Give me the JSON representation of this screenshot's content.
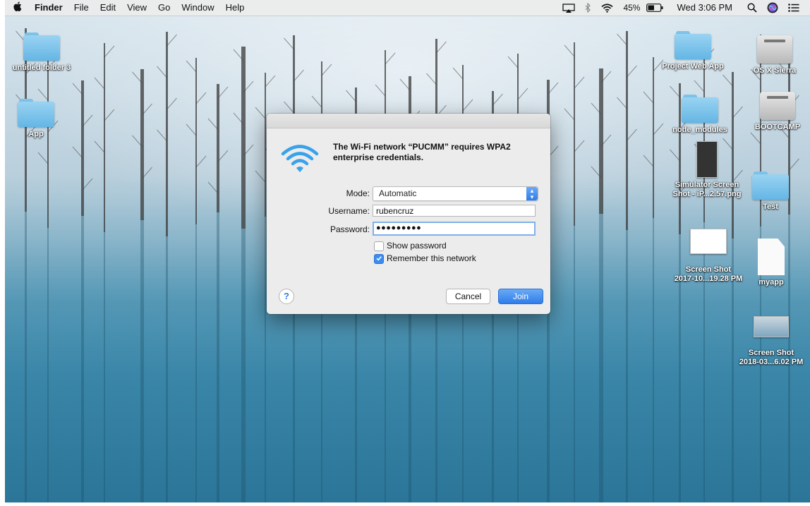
{
  "menubar": {
    "apple": "",
    "app": "Finder",
    "items": [
      "File",
      "Edit",
      "View",
      "Go",
      "Window",
      "Help"
    ],
    "battery": "45%",
    "clock": "Wed 3:06 PM"
  },
  "desktop": {
    "icons": [
      {
        "label": "untitled folder 3",
        "kind": "folder"
      },
      {
        "label": "App",
        "kind": "folder"
      },
      {
        "label": "Project Web App",
        "kind": "folder"
      },
      {
        "label": "OS X Sierra",
        "kind": "drive"
      },
      {
        "label": "node_modules",
        "kind": "folder"
      },
      {
        "label": "BOOTCAMP",
        "kind": "drive"
      },
      {
        "label": "Simulator Screen Shot - iP...2.57.png",
        "line1": "Simulator Screen",
        "line2": "Shot - iP...2.57.png",
        "kind": "image"
      },
      {
        "label": "Test",
        "kind": "folder"
      },
      {
        "label": "Screen Shot 2017-10...19.28 PM",
        "line1": "Screen Shot",
        "line2": "2017-10...19.28 PM",
        "kind": "image"
      },
      {
        "label": "myapp",
        "kind": "document"
      },
      {
        "label": "Screen Shot 2018-03...6.02 PM",
        "line1": "Screen Shot",
        "line2": "2018-03...6.02 PM",
        "kind": "image"
      }
    ]
  },
  "dialog": {
    "message": "The Wi-Fi network “PUCMM” requires WPA2 enterprise credentials.",
    "mode_label": "Mode:",
    "mode_value": "Automatic",
    "username_label": "Username:",
    "username_value": "rubencruz",
    "password_label": "Password:",
    "password_value": "●●●●●●●●●",
    "show_password_label": "Show password",
    "remember_label": "Remember this network",
    "cancel_label": "Cancel",
    "join_label": "Join",
    "help_label": "?"
  },
  "colors": {
    "accent": "#2f7de9",
    "wifi": "#3aa2ea",
    "folder": "#74bee8"
  }
}
